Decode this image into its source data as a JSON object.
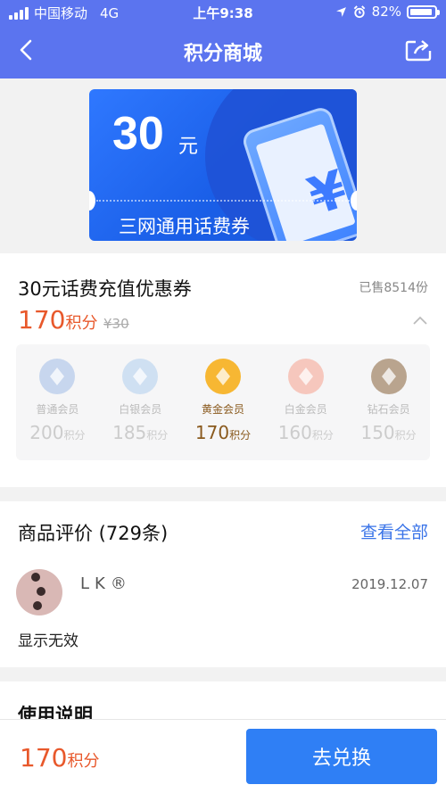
{
  "status_bar": {
    "carrier": "中国移动",
    "network": "4G",
    "time": "上午9:38",
    "battery": "82%"
  },
  "nav": {
    "title": "积分商城"
  },
  "banner": {
    "amount": "30",
    "unit": "元",
    "subtitle": "三网通用话费券"
  },
  "product": {
    "name": "30元话费充值优惠券",
    "sold": "已售8514份",
    "price_value": "170",
    "price_unit": "积分",
    "original_price": "¥30",
    "levels": [
      {
        "name": "普通会员",
        "points": "200",
        "unit": "积分",
        "color": "#c7d6ee"
      },
      {
        "name": "白银会员",
        "points": "185",
        "unit": "积分",
        "color": "#cfe0f2"
      },
      {
        "name": "黄金会员",
        "points": "170",
        "unit": "积分",
        "color": "#f7b733"
      },
      {
        "name": "白金会员",
        "points": "160",
        "unit": "积分",
        "color": "#f6c7bd"
      },
      {
        "name": "钻石会员",
        "points": "150",
        "unit": "积分",
        "color": "#b9a48e"
      }
    ],
    "active_level": "黄金会员"
  },
  "reviews": {
    "title": "商品评价 (729条)",
    "view_all": "查看全部",
    "items": [
      {
        "user": "LK®",
        "date": "2019.12.07",
        "content": "显示无效"
      }
    ]
  },
  "usage": {
    "title": "使用说明"
  },
  "bottom": {
    "price_value": "170",
    "price_unit": "积分",
    "button": "去兑换"
  },
  "colors": {
    "nav": "#5b74ef",
    "accent": "#e8582b",
    "button": "#2f7ff5",
    "link": "#3a74e8"
  }
}
